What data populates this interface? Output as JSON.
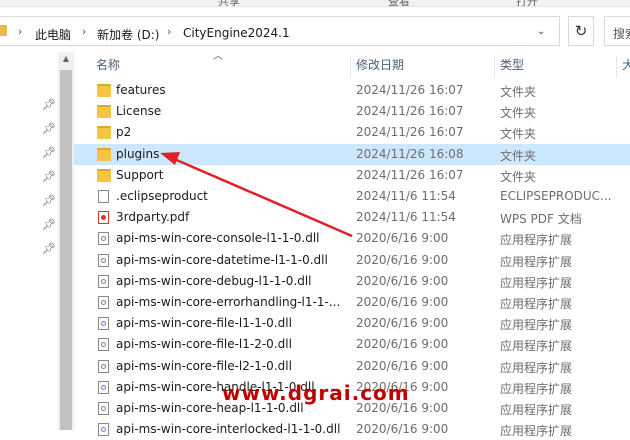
{
  "top_strip": {
    "items": [
      "",
      "共享",
      "查看",
      "打开",
      ""
    ]
  },
  "address": {
    "crumbs": [
      "此电脑",
      "新加卷 (D:)",
      "CityEngine2024.1"
    ],
    "search_placeholder": "搜索\"Ci"
  },
  "columns": {
    "name": "名称",
    "date": "修改日期",
    "type": "类型",
    "size": "大"
  },
  "files": [
    {
      "name": "features",
      "date": "2024/11/26 16:07",
      "type": "文件夹",
      "icon": "folder-icon"
    },
    {
      "name": "License",
      "date": "2024/11/26 16:07",
      "type": "文件夹",
      "icon": "folder-icon"
    },
    {
      "name": "p2",
      "date": "2024/11/26 16:07",
      "type": "文件夹",
      "icon": "folder-icon"
    },
    {
      "name": "plugins",
      "date": "2024/11/26 16:08",
      "type": "文件夹",
      "icon": "folder-icon",
      "selected": true
    },
    {
      "name": "Support",
      "date": "2024/11/26 16:07",
      "type": "文件夹",
      "icon": "folder-icon"
    },
    {
      "name": ".eclipseproduct",
      "date": "2024/11/6 11:54",
      "type": "ECLIPSEPRODUC...",
      "icon": "document-icon"
    },
    {
      "name": "3rdparty.pdf",
      "date": "2024/11/6 11:54",
      "type": "WPS PDF 文档",
      "icon": "pdf-icon"
    },
    {
      "name": "api-ms-win-core-console-l1-1-0.dll",
      "date": "2020/6/16 9:00",
      "type": "应用程序扩展",
      "icon": "dll-icon"
    },
    {
      "name": "api-ms-win-core-datetime-l1-1-0.dll",
      "date": "2020/6/16 9:00",
      "type": "应用程序扩展",
      "icon": "dll-icon"
    },
    {
      "name": "api-ms-win-core-debug-l1-1-0.dll",
      "date": "2020/6/16 9:00",
      "type": "应用程序扩展",
      "icon": "dll-icon"
    },
    {
      "name": "api-ms-win-core-errorhandling-l1-1-...",
      "date": "2020/6/16 9:00",
      "type": "应用程序扩展",
      "icon": "dll-icon"
    },
    {
      "name": "api-ms-win-core-file-l1-1-0.dll",
      "date": "2020/6/16 9:00",
      "type": "应用程序扩展",
      "icon": "dll-icon"
    },
    {
      "name": "api-ms-win-core-file-l1-2-0.dll",
      "date": "2020/6/16 9:00",
      "type": "应用程序扩展",
      "icon": "dll-icon"
    },
    {
      "name": "api-ms-win-core-file-l2-1-0.dll",
      "date": "2020/6/16 9:00",
      "type": "应用程序扩展",
      "icon": "dll-icon"
    },
    {
      "name": "api-ms-win-core-handle-l1-1-0.dll",
      "date": "2020/6/16 9:00",
      "type": "应用程序扩展",
      "icon": "dll-icon"
    },
    {
      "name": "api-ms-win-core-heap-l1-1-0.dll",
      "date": "2020/6/16 9:00",
      "type": "应用程序扩展",
      "icon": "dll-icon"
    },
    {
      "name": "api-ms-win-core-interlocked-l1-1-0.dll",
      "date": "2020/6/16 9:00",
      "type": "应用程序扩展",
      "icon": "dll-icon"
    }
  ],
  "watermark": "www.dgrai.com",
  "annotation": {
    "arrow_color": "#e0202a"
  }
}
